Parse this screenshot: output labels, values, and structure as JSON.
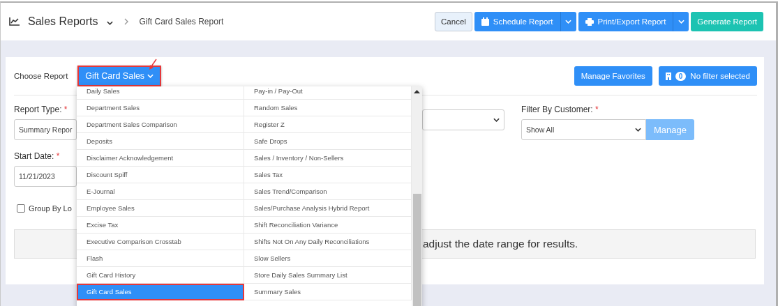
{
  "header": {
    "title": "Sales Reports",
    "breadcrumb": "Gift Card Sales Report",
    "buttons": [
      {
        "label": "Cancel",
        "kind": "plain"
      },
      {
        "label": "Schedule Report",
        "kind": "split"
      },
      {
        "label": "Print/Export Report",
        "kind": "split"
      },
      {
        "label": "Generate Report",
        "kind": "primary"
      }
    ]
  },
  "choose_report": {
    "label": "Choose Report",
    "value": "Gift Card Sales",
    "expanded": true,
    "highlighted": true
  },
  "toolbar": {
    "favorites": "Manage Favorites",
    "filter_count": "0",
    "filter_label": "No filter selected"
  },
  "report_menu": {
    "columns": [
      [
        {
          "label": "Daily Sales",
          "selected": false
        },
        {
          "label": "Department Sales",
          "selected": false
        },
        {
          "label": "Department Sales Comparison",
          "selected": false
        },
        {
          "label": "Deposits",
          "selected": false
        },
        {
          "label": "Disclaimer Acknowledgement",
          "selected": false
        },
        {
          "label": "Discount Spiff",
          "selected": false
        },
        {
          "label": "E-Journal",
          "selected": false
        },
        {
          "label": "Employee Sales",
          "selected": false
        },
        {
          "label": "Excise Tax",
          "selected": false
        },
        {
          "label": "Executive Comparison Crosstab",
          "selected": false
        },
        {
          "label": "Flash",
          "selected": false
        },
        {
          "label": "Gift Card History",
          "selected": false
        },
        {
          "label": "Gift Card Sales",
          "selected": true
        }
      ],
      [
        {
          "label": "Pay-in / Pay-Out",
          "selected": false
        },
        {
          "label": "Random Sales",
          "selected": false
        },
        {
          "label": "Register Z",
          "selected": false
        },
        {
          "label": "Safe Drops",
          "selected": false
        },
        {
          "label": "Sales / Inventory / Non-Sellers",
          "selected": false
        },
        {
          "label": "Sales Tax",
          "selected": false
        },
        {
          "label": "Sales Trend/Comparison",
          "selected": false
        },
        {
          "label": "Sales/Purchase Analysis Hybrid Report",
          "selected": false
        },
        {
          "label": "Shift Reconciliation Variance",
          "selected": false
        },
        {
          "label": "Shifts Not On Any Daily Reconciliations",
          "selected": false
        },
        {
          "label": "Slow Sellers",
          "selected": false
        },
        {
          "label": "Store Daily Sales Summary List",
          "selected": false
        },
        {
          "label": "Summary Sales",
          "selected": false
        }
      ]
    ]
  },
  "form": {
    "report_type": {
      "label": "Report Type:",
      "required_mark": "*",
      "value": "Summary Repor"
    },
    "filter_customer": {
      "label": "Filter By Customer:",
      "required_mark": "*",
      "value": "Show All",
      "button": "Manage"
    },
    "start_date": {
      "label": "Start Date:",
      "required_mark": "*",
      "value": "11/21/2023"
    },
    "group_by": {
      "label": "Group By Lo",
      "checked": false
    },
    "message": "adjust the date range for results."
  }
}
